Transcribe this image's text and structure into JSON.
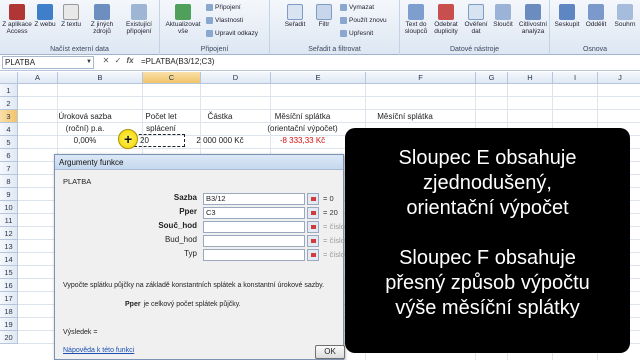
{
  "ribbon": {
    "groups": [
      {
        "label": "Načíst externí data",
        "buttons": [
          "Z aplikace Access",
          "Z webu",
          "Z textu",
          "Z jiných zdrojů",
          "Existující připojení"
        ]
      },
      {
        "label": "Připojení",
        "buttons": [
          "Aktualizovat vše"
        ],
        "small": [
          "Připojení",
          "Vlastnosti",
          "Upravit odkazy"
        ]
      },
      {
        "label": "Seřadit a filtrovat",
        "buttons": [
          "Seřadit",
          "Filtr"
        ],
        "small": [
          "Vymazat",
          "Použít znovu",
          "Upřesnit"
        ]
      },
      {
        "label": "Datové nástroje",
        "buttons": [
          "Text do sloupců",
          "Odebrat duplicity",
          "Ověření dat",
          "Sloučit",
          "Citlivostní analýza"
        ]
      },
      {
        "label": "Osnova",
        "buttons": [
          "Seskupit",
          "Oddělit",
          "Souhrn"
        ]
      }
    ]
  },
  "formula_bar": {
    "name_box": "PLATBA",
    "formula": "=PLATBA(B3/12;C3)"
  },
  "grid": {
    "columns": [
      "A",
      "B",
      "C",
      "D",
      "E",
      "F",
      "G",
      "H",
      "I",
      "J",
      "K"
    ],
    "rows": [
      "1",
      "2",
      "3",
      "4",
      "5",
      "6",
      "7",
      "8",
      "9",
      "10",
      "11",
      "12",
      "13",
      "14",
      "15",
      "16",
      "17",
      "18",
      "19",
      "20"
    ],
    "header_b": [
      "Úroková sazba",
      "(roční) p.a."
    ],
    "header_c": [
      "Počet let",
      "splácení"
    ],
    "header_d": "Částka",
    "header_e": [
      "Měsíční splátka",
      "(orientační výpočet)"
    ],
    "header_f": "Měsíční splátka",
    "b3": "0,00%",
    "c3": "20",
    "d3": "2 000 000 Kč",
    "e3": "-8 333,33 Kč"
  },
  "dialog": {
    "title": "Argumenty funkce",
    "function": "PLATBA",
    "args": [
      {
        "label": "Sazba",
        "value": "B3/12",
        "result": "= 0",
        "bold": true
      },
      {
        "label": "Pper",
        "value": "C3",
        "result": "= 20",
        "bold": true
      },
      {
        "label": "Souč_hod",
        "value": "",
        "result": "= číslo",
        "bold": true
      },
      {
        "label": "Bud_hod",
        "value": "",
        "result": "= číslo",
        "bold": false
      },
      {
        "label": "Typ",
        "value": "",
        "result": "= číslo",
        "bold": false
      }
    ],
    "description": "Vypočte splátku půjčky na základě konstantních splátek a konstantní úrokové sazby.",
    "param_name": "Pper",
    "param_desc": "je celkový počet splátek půjčky.",
    "result_label": "Výsledek =",
    "help_link": "Nápověda k této funkci",
    "ok": "OK"
  },
  "overlay": {
    "p1": [
      "Sloupec E obsahuje",
      "zjednodušený,",
      "orientační výpočet"
    ],
    "p2": [
      "Sloupec F obsahuje",
      "přesný způsob výpočtu",
      "výše měsíční splátky"
    ]
  }
}
